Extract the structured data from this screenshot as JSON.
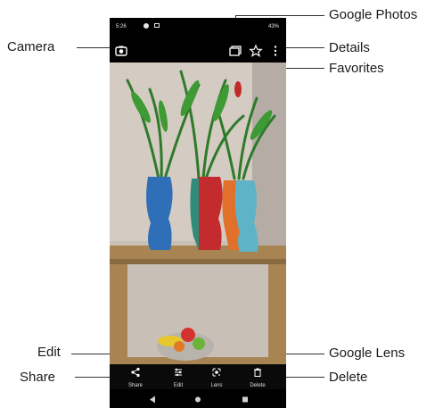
{
  "callouts": {
    "camera": "Camera",
    "google_photos": "Google Photos",
    "details": "Details",
    "favorites": "Favorites",
    "edit": "Edit",
    "share": "Share",
    "google_lens": "Google Lens",
    "delete": "Delete"
  },
  "status_bar": {
    "time": "5:26",
    "battery": "43%"
  },
  "top_bar_icons": [
    "camera-icon",
    "google-photos-icon",
    "star-icon",
    "more-vert-icon"
  ],
  "actions": {
    "share_label": "Share",
    "edit_label": "Edit",
    "lens_label": "Lens",
    "delete_label": "Delete"
  },
  "nav_icons": [
    "back-icon",
    "home-icon",
    "recents-icon"
  ],
  "colors": {
    "phone_bg": "#000000",
    "callout_text": "#1a1a1a",
    "leader_line": "#333333"
  }
}
